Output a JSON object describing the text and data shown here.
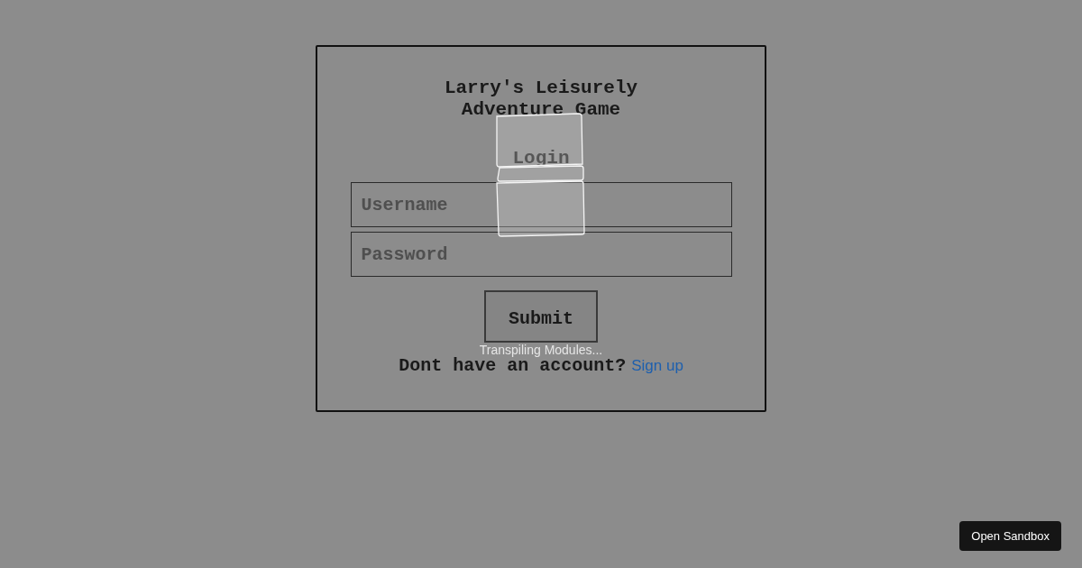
{
  "card": {
    "title": "Larry's Leisurely Adventure Game",
    "heading": "Login",
    "fields": [
      {
        "placeholder": "Username"
      },
      {
        "placeholder": "Password"
      }
    ],
    "submit": "Submit",
    "prompt": "Dont have an account?",
    "link": "Sign up"
  },
  "loading": {
    "status": "Transpiling Modules..."
  },
  "open_button": "Open Sandbox"
}
